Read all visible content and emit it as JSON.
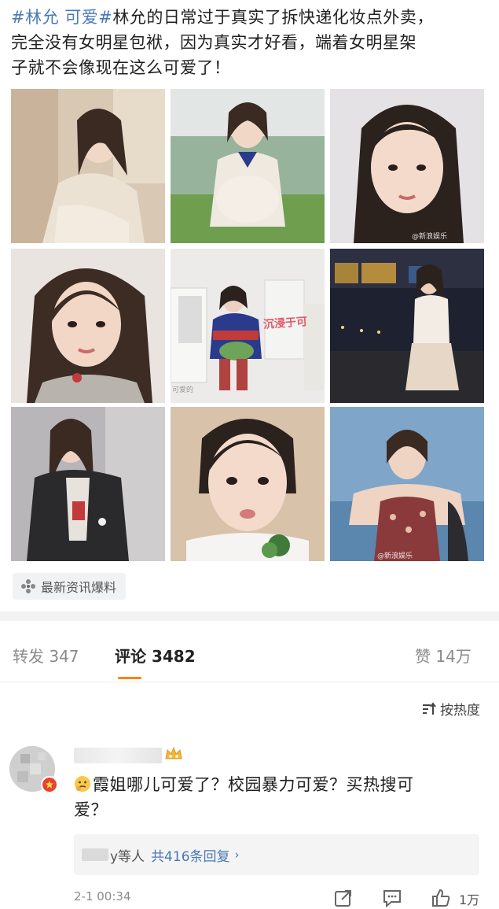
{
  "post": {
    "tags": [
      "#林允",
      "可爱#"
    ],
    "body_line1": "林允的日常过于真实了拆快递化妆点外卖，",
    "body_line2": "完全没有女明星包袱，因为真实才好看，端着女明星架",
    "body_line3": "子就不会像现在这么可爱了！"
  },
  "photos": {
    "overlay_text": "沉浸于可",
    "wm_left": "可爱的"
  },
  "source_tag": {
    "icon": "pinwheel-icon",
    "label": "最新资讯爆料"
  },
  "stats": {
    "repost_label": "转发",
    "repost_count": "347",
    "comment_label": "评论",
    "comment_count": "3482",
    "like_label": "赞",
    "like_count": "14万"
  },
  "sort": {
    "icon": "sort-icon",
    "label": "按热度"
  },
  "comment": {
    "text_line1": "霞姐哪儿可爱了？校园暴力可爱？买热搜可",
    "text_line2": "爱？",
    "replies_suffix": "y等人",
    "replies_link": "共416条回复",
    "time": "2-1 00:34",
    "like_count": "1万"
  },
  "colors": {
    "link": "#4a78b8",
    "accent": "#ff8200",
    "badge": "#e8412f"
  }
}
